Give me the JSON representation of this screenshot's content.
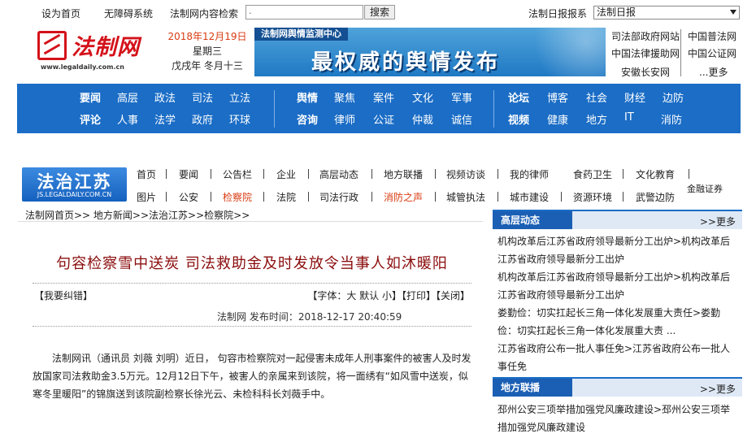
{
  "topbar": {
    "set_home": "设为首页",
    "accessibility": "无障碍系统",
    "site_search_label": "法制网内容检索",
    "search_placeholder": ".",
    "search_button": "搜索",
    "newspaper_label": "法制日报报系",
    "newspaper_select": "法制日报"
  },
  "header": {
    "logo_text": "法制网",
    "logo_url": "www.legaldaily.com.cn",
    "date": "2018年12月19日",
    "weekday": "星期三",
    "lunar": "戊戌年 冬月十三",
    "banner_head": "法制网舆情监测中心",
    "banner_main": "最权威的舆情发布",
    "links": [
      "司法部政府网站",
      "中国普法网",
      "中国法律援助网",
      "中国公证网",
      "安徽长安网",
      "...更多"
    ]
  },
  "mainnav": {
    "group1_row1": [
      "要闻",
      "高层",
      "政法",
      "司法",
      "立法"
    ],
    "group1_row2": [
      "评论",
      "人事",
      "法学",
      "政府",
      "环球"
    ],
    "group2_row1": [
      "舆情",
      "聚焦",
      "案件",
      "文化",
      "军事"
    ],
    "group2_row2": [
      "咨询",
      "律师",
      "公证",
      "仲裁",
      "诚信"
    ],
    "group3_row1": [
      "论坛",
      "博客",
      "社会",
      "财经",
      "边防"
    ],
    "group3_row2": [
      "视频",
      "健康",
      "地方",
      "IT",
      "消防"
    ]
  },
  "channel": {
    "logo_title": "法治江苏",
    "logo_url": "JS.LEGALDAILY.COM.CN",
    "row1": [
      "首页",
      "要闻",
      "公告栏",
      "企业",
      "高层动态",
      "地方联播",
      "视频访谈",
      "我的律师",
      "食药卫生",
      "文化教育"
    ],
    "row2": [
      "图片",
      "公安",
      "检察院",
      "法院",
      "司法行政",
      "消防之声",
      "城管执法",
      "城市建设",
      "资源环境",
      "武警边防",
      "金融证券"
    ]
  },
  "breadcrumb": "法制网首页>>  地方新闻>>法治江苏>>检察院>>",
  "article": {
    "title": "句容检察雪中送炭  司法救助金及时发放令当事人如沐暖阳",
    "report_error": "【我要纠错】",
    "tools": "【字体：大 默认 小】【打印】【关闭】",
    "meta": "法制网  发布时间：2018-12-17 20:40:59",
    "body": "法制网讯（通讯员 刘薇 刘明）近日， 句容市检察院对一起侵害未成年人刑事案件的被害人及时发放国家司法救助金3.5万元。12月12日下午，被害人的亲属来到该院，将一面绣有“如风雪中送炭，似寒冬里暖阳”的锦旗送到该院副检察长徐光云、未检科科长刘薇手中。"
  },
  "sidebar": {
    "section1": {
      "title": "高层动态",
      "more": ">>更多",
      "items": [
        "机构改革后江苏省政府领导最新分工出炉>机构改革后",
        "江苏省政府领导最新分工出炉",
        "机构改革后江苏省政府领导最新分工出炉>机构改革后",
        "江苏省政府领导最新分工出炉",
        "娄勤俭：切实扛起长三角一体化发展重大责任>娄勤",
        "俭：切实扛起长三角一体化发展重大责 ...",
        "江苏省政府公布一批人事任免>江苏省政府公布一批人",
        "事任免"
      ]
    },
    "section2": {
      "title": "地方联播",
      "more": ">>更多",
      "items": [
        "邳州公安三项举措加强党风廉政建设>邳州公安三项举",
        "措加强党风廉政建设"
      ]
    }
  },
  "colors": {
    "nav_blue": "#1b6dc6",
    "title_red": "#8b0d0d",
    "logo_red": "#d4121a"
  }
}
